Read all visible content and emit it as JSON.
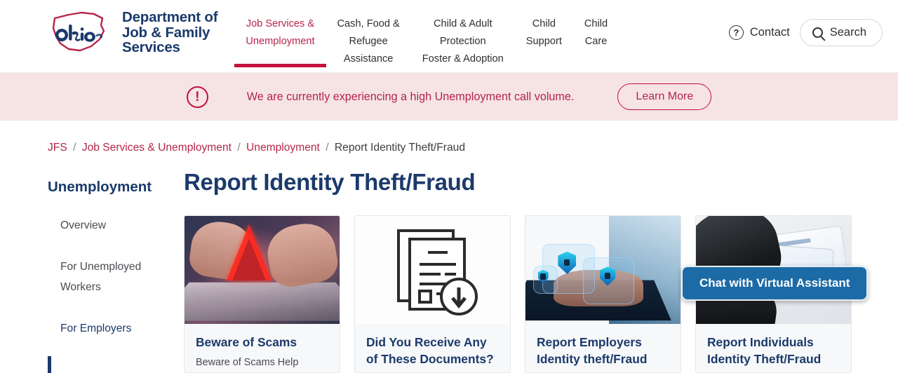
{
  "header": {
    "logo_alt": "Ohio",
    "brand_lines": [
      "Department of",
      "Job & Family",
      "Services"
    ],
    "nav": [
      {
        "line1": "Job Services &",
        "line2": "Unemployment",
        "active": true
      },
      {
        "line1": "Cash, Food &",
        "line2": "Refugee",
        "line3": "Assistance",
        "active": false
      },
      {
        "line1": "Child & Adult",
        "line2": "Protection",
        "line3": "Foster & Adoption",
        "active": false
      },
      {
        "line1": "Child",
        "line2": "Support",
        "active": false
      },
      {
        "line1": "Child",
        "line2": "Care",
        "active": false
      }
    ],
    "contact_label": "Contact",
    "contact_icon": "question-circle-icon",
    "search_label": "Search",
    "search_icon": "search-icon"
  },
  "alert": {
    "icon": "exclamation-circle-icon",
    "message": "We are currently experiencing a high Unemployment call volume.",
    "button_label": "Learn More"
  },
  "breadcrumb": {
    "items": [
      "JFS",
      "Job Services & Unemployment",
      "Unemployment"
    ],
    "current": "Report Identity Theft/Fraud",
    "separator": "/"
  },
  "sidebar": {
    "heading": "Unemployment",
    "items": [
      {
        "label": "Overview",
        "active": false
      },
      {
        "label": "For Unemployed Workers",
        "active": false
      },
      {
        "label": "For Employers",
        "active": true
      }
    ]
  },
  "main": {
    "page_title": "Report Identity Theft/Fraud",
    "cards": [
      {
        "title": "Beware of Scams",
        "desc": "Beware of Scams Help",
        "image": "laptop-hands-warning-triangle"
      },
      {
        "title": "Did You Receive Any of These Documents?",
        "desc": "",
        "image": "documents-download-icon"
      },
      {
        "title": "Report Employers Identity theft/Fraud",
        "desc": "",
        "image": "cybersecurity-shields-laptop"
      },
      {
        "title": "Report Individuals Identity Theft/Fraud",
        "desc": "",
        "image": "gloved-hand-stealing-id-cards"
      }
    ]
  },
  "chat": {
    "label": "Chat with Virtual Assistant"
  },
  "colors": {
    "brand_navy": "#1b3a6b",
    "crimson": "#c3123b",
    "link_maroon": "#b5254a",
    "alert_bg": "#f6e4e4",
    "chat_blue": "#1d6ba6"
  }
}
